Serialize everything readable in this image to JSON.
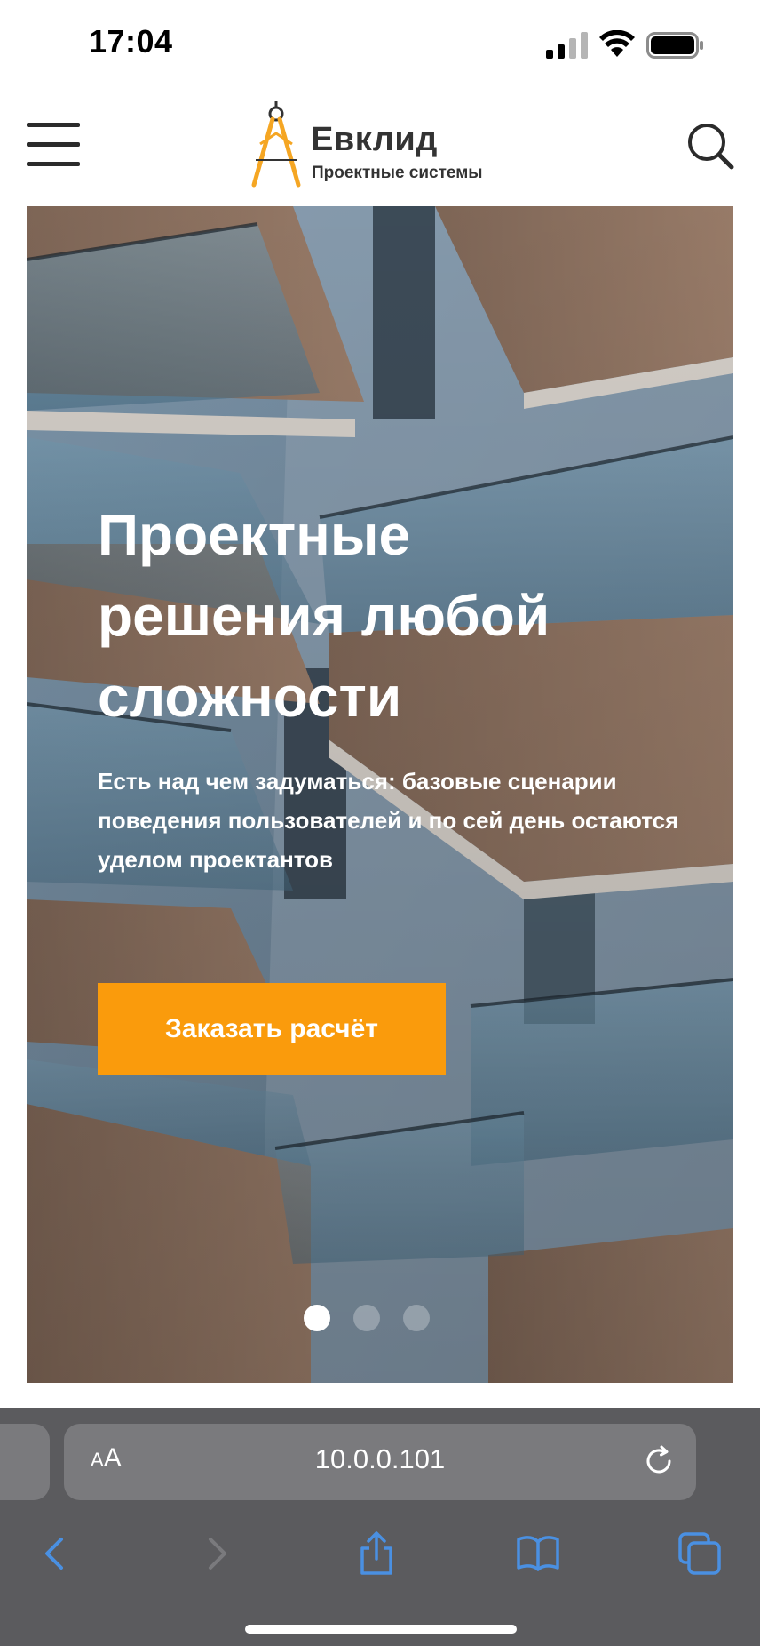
{
  "status_bar": {
    "time": "17:04"
  },
  "header": {
    "logo_name": "Евклид",
    "logo_subtitle": "Проектные системы",
    "menu_icon": "hamburger-menu-icon",
    "search_icon": "search-icon"
  },
  "hero": {
    "title": "Проектные решения любой сложности",
    "subtitle": "Есть над чем задуматься: базовые сценарии поведения пользователей и по сей день остаются уделом проектантов",
    "cta_label": "Заказать расчёт",
    "slider": {
      "total_slides": 3,
      "active_slide": 1
    },
    "colors": {
      "accent": "#fa9b0c",
      "text": "#ffffff"
    }
  },
  "browser": {
    "text_size_label": "AA",
    "url": "10.0.0.101",
    "toolbar_icons": [
      "back-icon",
      "forward-icon",
      "share-icon",
      "bookmarks-icon",
      "tabs-icon"
    ],
    "colors": {
      "toolbar_icon": "#4a90e2",
      "chrome_bg": "#5b5b5e"
    }
  }
}
